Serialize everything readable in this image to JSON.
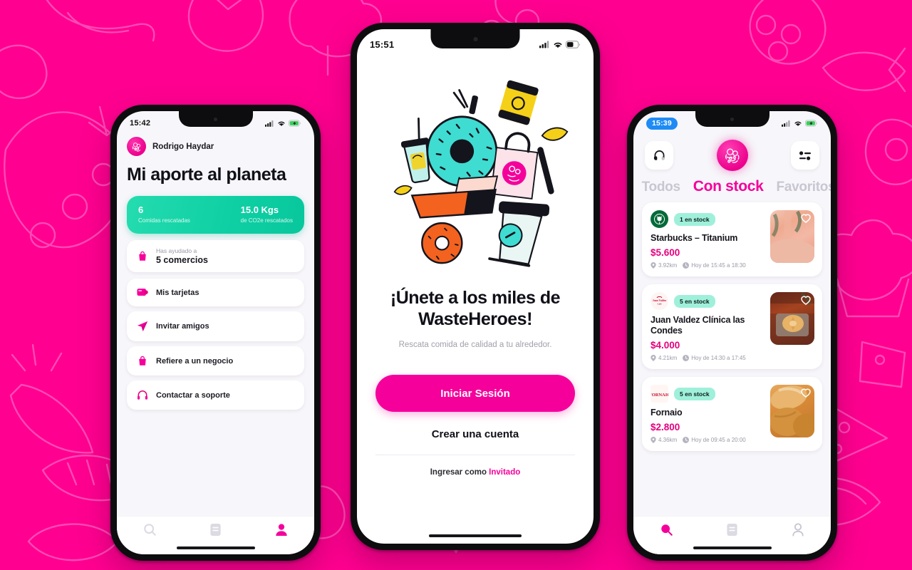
{
  "background": {
    "color": "#FF0090",
    "pattern_color": "#FF45B4",
    "pattern_name": "food-doodles-pattern"
  },
  "theme": {
    "magenta": "#F5009B",
    "teal": "#0FD0A4",
    "mint_badge": "#9FF0DB",
    "price": "#E5007E",
    "dark": "#101018"
  },
  "phone_left": {
    "status": {
      "time": "15:42",
      "signal_icon": "cellular-icon",
      "wifi_icon": "wifi-icon",
      "battery_icon": "battery-charging-icon"
    },
    "user": {
      "name": "Rodrigo Haydar",
      "avatar_icon": "wasteheroes-logo-icon"
    },
    "title": "Mi aporte al planeta",
    "stats": [
      {
        "value": "6",
        "label": "Comidas rescatadas"
      },
      {
        "value": "15.0 Kgs",
        "label": "de CO2e rescatados"
      }
    ],
    "helped": {
      "sub": "Has ayudado a",
      "value": "5 comercios",
      "icon": "bag-icon"
    },
    "menu": [
      {
        "label": "Mis tarjetas",
        "icon": "card-icon"
      },
      {
        "label": "Invitar amigos",
        "icon": "send-icon"
      },
      {
        "label": "Refiere a un negocio",
        "icon": "bag-icon"
      },
      {
        "label": "Contactar a soporte",
        "icon": "headset-icon"
      }
    ],
    "tabs": [
      {
        "name": "search",
        "icon": "search-icon",
        "active": false
      },
      {
        "name": "orders",
        "icon": "receipt-icon",
        "active": false
      },
      {
        "name": "profile",
        "icon": "person-icon",
        "active": true
      }
    ]
  },
  "phone_center": {
    "status": {
      "time": "15:51",
      "signal_icon": "cellular-icon",
      "wifi_icon": "wifi-icon",
      "battery_icon": "battery-icon"
    },
    "hero_icon": "food-items-illustration",
    "headline": "¡Únete a los miles de WasteHeroes!",
    "subtitle": "Rescata comida de calidad a tu alrededor.",
    "primary_button": "Iniciar Sesión",
    "secondary_button": "Crear una cuenta",
    "guest_prefix": "Ingresar como ",
    "guest_link": "Invitado"
  },
  "phone_right": {
    "status": {
      "time": "15:39",
      "time_is_pill": true,
      "signal_icon": "cellular-icon",
      "wifi_icon": "wifi-icon",
      "battery_icon": "battery-charging-icon"
    },
    "header": {
      "left_icon": "headset-icon",
      "logo_icon": "wasteheroes-logo-icon",
      "right_icon": "filter-sliders-icon"
    },
    "tabs": [
      {
        "label": "Todos",
        "active": false
      },
      {
        "label": "Con stock",
        "active": true
      },
      {
        "label": "Favoritos",
        "active": false
      }
    ],
    "deals": [
      {
        "brand": "Starbucks",
        "brand_logo_icon": "starbucks-logo-icon",
        "stock": "1 en stock",
        "name": "Starbucks – Titanium",
        "price": "$5.600",
        "distance": "3.92km",
        "window": "Hoy de 15:45 a 18:30",
        "distance_icon": "pin-icon",
        "time_icon": "clock-icon",
        "favorite_icon": "heart-icon",
        "thumb_name": "starbucks-product-photo"
      },
      {
        "brand": "Juan Valdez",
        "brand_logo_icon": "juan-valdez-logo-icon",
        "stock": "5 en stock",
        "name": "Juan Valdez Clínica las Condes",
        "price": "$4.000",
        "distance": "4.21km",
        "window": "Hoy de 14:30 a 17:45",
        "distance_icon": "pin-icon",
        "time_icon": "clock-icon",
        "favorite_icon": "heart-icon",
        "thumb_name": "juan-valdez-product-photo"
      },
      {
        "brand": "Fornaio",
        "brand_logo_icon": "fornaio-logo-icon",
        "stock": "5 en stock",
        "name": "Fornaio",
        "price": "$2.800",
        "distance": "4.36km",
        "window": "Hoy de 09:45 a 20:00",
        "distance_icon": "pin-icon",
        "time_icon": "clock-icon",
        "favorite_icon": "heart-icon",
        "thumb_name": "fornaio-product-photo"
      }
    ],
    "tabs_bottom": [
      {
        "name": "search",
        "icon": "search-icon",
        "active": true
      },
      {
        "name": "orders",
        "icon": "receipt-icon",
        "active": false
      },
      {
        "name": "profile",
        "icon": "person-icon",
        "active": false
      }
    ]
  }
}
